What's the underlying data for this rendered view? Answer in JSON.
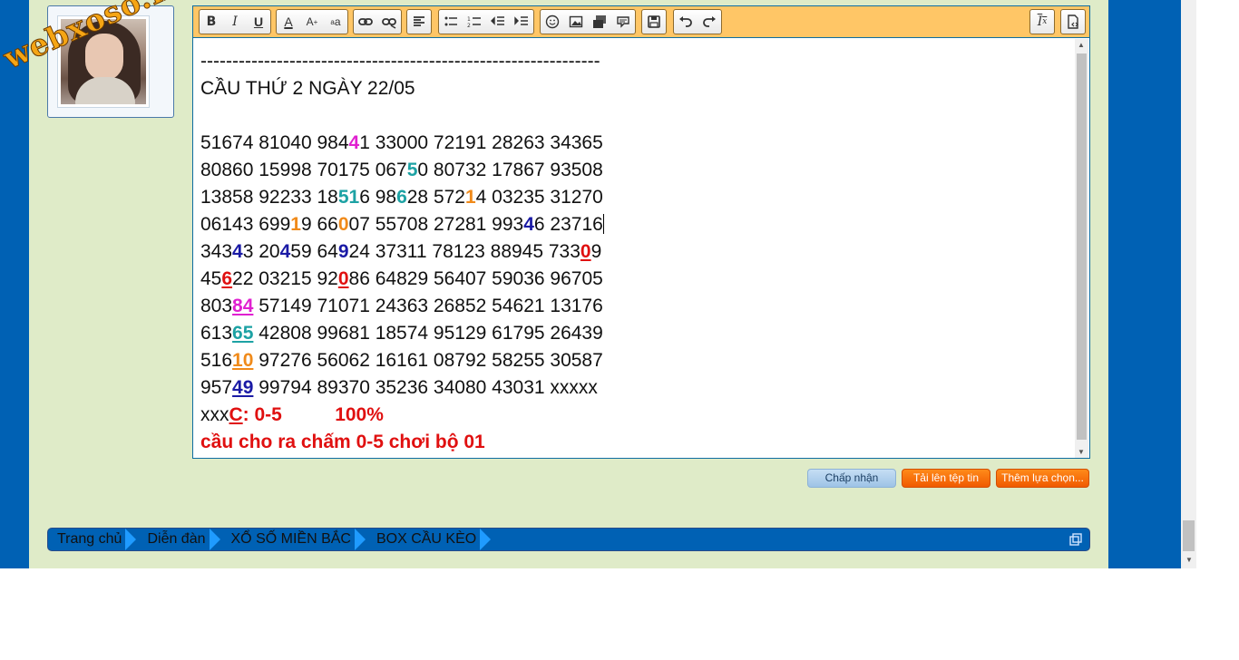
{
  "watermark": {
    "text": "webxoso.net"
  },
  "toolbar": {
    "buttons": {
      "bold": "B",
      "italic": "I",
      "underline": "U",
      "font_color": "A",
      "font_size": "A",
      "font_family": "a",
      "remove_format": "I"
    }
  },
  "post": {
    "lines": [
      [
        "---------------------------------------------------------------"
      ],
      [
        "CẦU THỨ 2 NGÀY 22/05"
      ],
      [
        ""
      ],
      [
        "51674 81040 984",
        {
          "t": "4",
          "c": "mag"
        },
        "1 33000 72191 28263 34365"
      ],
      [
        "80860 15998 70175 067",
        {
          "t": "5",
          "c": "teal"
        },
        "0 80732 17867 93508"
      ],
      [
        "13858 92233 18",
        {
          "t": "51",
          "c": "teal"
        },
        "6 98",
        {
          "t": "6",
          "c": "teal"
        },
        "28 572",
        {
          "t": "1",
          "c": "orange"
        },
        "4 03235 31270"
      ],
      [
        "06143 699",
        {
          "t": "1",
          "c": "orange"
        },
        "9 66",
        {
          "t": "0",
          "c": "orange"
        },
        "07 55708 27281 993",
        {
          "t": "4",
          "c": "blue"
        },
        "6 23716",
        {
          "caret": true
        }
      ],
      [
        "343",
        {
          "t": "4",
          "c": "blue"
        },
        "3 20",
        {
          "t": "4",
          "c": "blue"
        },
        "59 64",
        {
          "t": "9",
          "c": "blue"
        },
        "24 37311 78123 88945 733",
        {
          "t": "0",
          "c": "red u"
        },
        "9"
      ],
      [
        "45",
        {
          "t": "6",
          "c": "red u"
        },
        "22 03215 92",
        {
          "t": "0",
          "c": "red u"
        },
        "86 64829 56407 59036 96705"
      ],
      [
        "803",
        {
          "t": "84",
          "c": "mag u"
        },
        " 57149 71071 24363 26852 54621 13176"
      ],
      [
        "613",
        {
          "t": "65",
          "c": "teal u"
        },
        " 42808 99681 18574 95129 61795 26439"
      ],
      [
        "516",
        {
          "t": "10",
          "c": "orange u"
        },
        " 97276 56062 16161 08792 58255 30587"
      ],
      [
        "957",
        {
          "t": "49",
          "c": "blue u"
        },
        " 99794 89370 35236 34080 43031 xxxxx"
      ],
      [
        "xxx",
        {
          "t": "C",
          "c": "red u"
        },
        {
          "t": ": 0-5          100%",
          "c": "red"
        }
      ],
      [
        {
          "t": "cầu cho ra chấm 0-5 chơi bộ 01",
          "c": "red"
        }
      ]
    ]
  },
  "actions": {
    "accept": "Chấp nhận",
    "upload": "Tải lên tệp tin",
    "more_options": "Thêm lựa chọn..."
  },
  "breadcrumb": [
    "Trang chủ",
    "Diễn đàn",
    "XỔ SỐ MIỀN BẮC",
    "BOX CẦU KÈO"
  ],
  "colors": {
    "frame_blue": "#0061b4",
    "content_bg": "#dfebc8",
    "toolbar_bg": "#ffc666",
    "red": "#e01010",
    "blue": "#1a1aa5",
    "teal": "#1da2a4",
    "orange": "#f08a1a",
    "magenta": "#e020d0",
    "button_orange": "#f05a00"
  }
}
